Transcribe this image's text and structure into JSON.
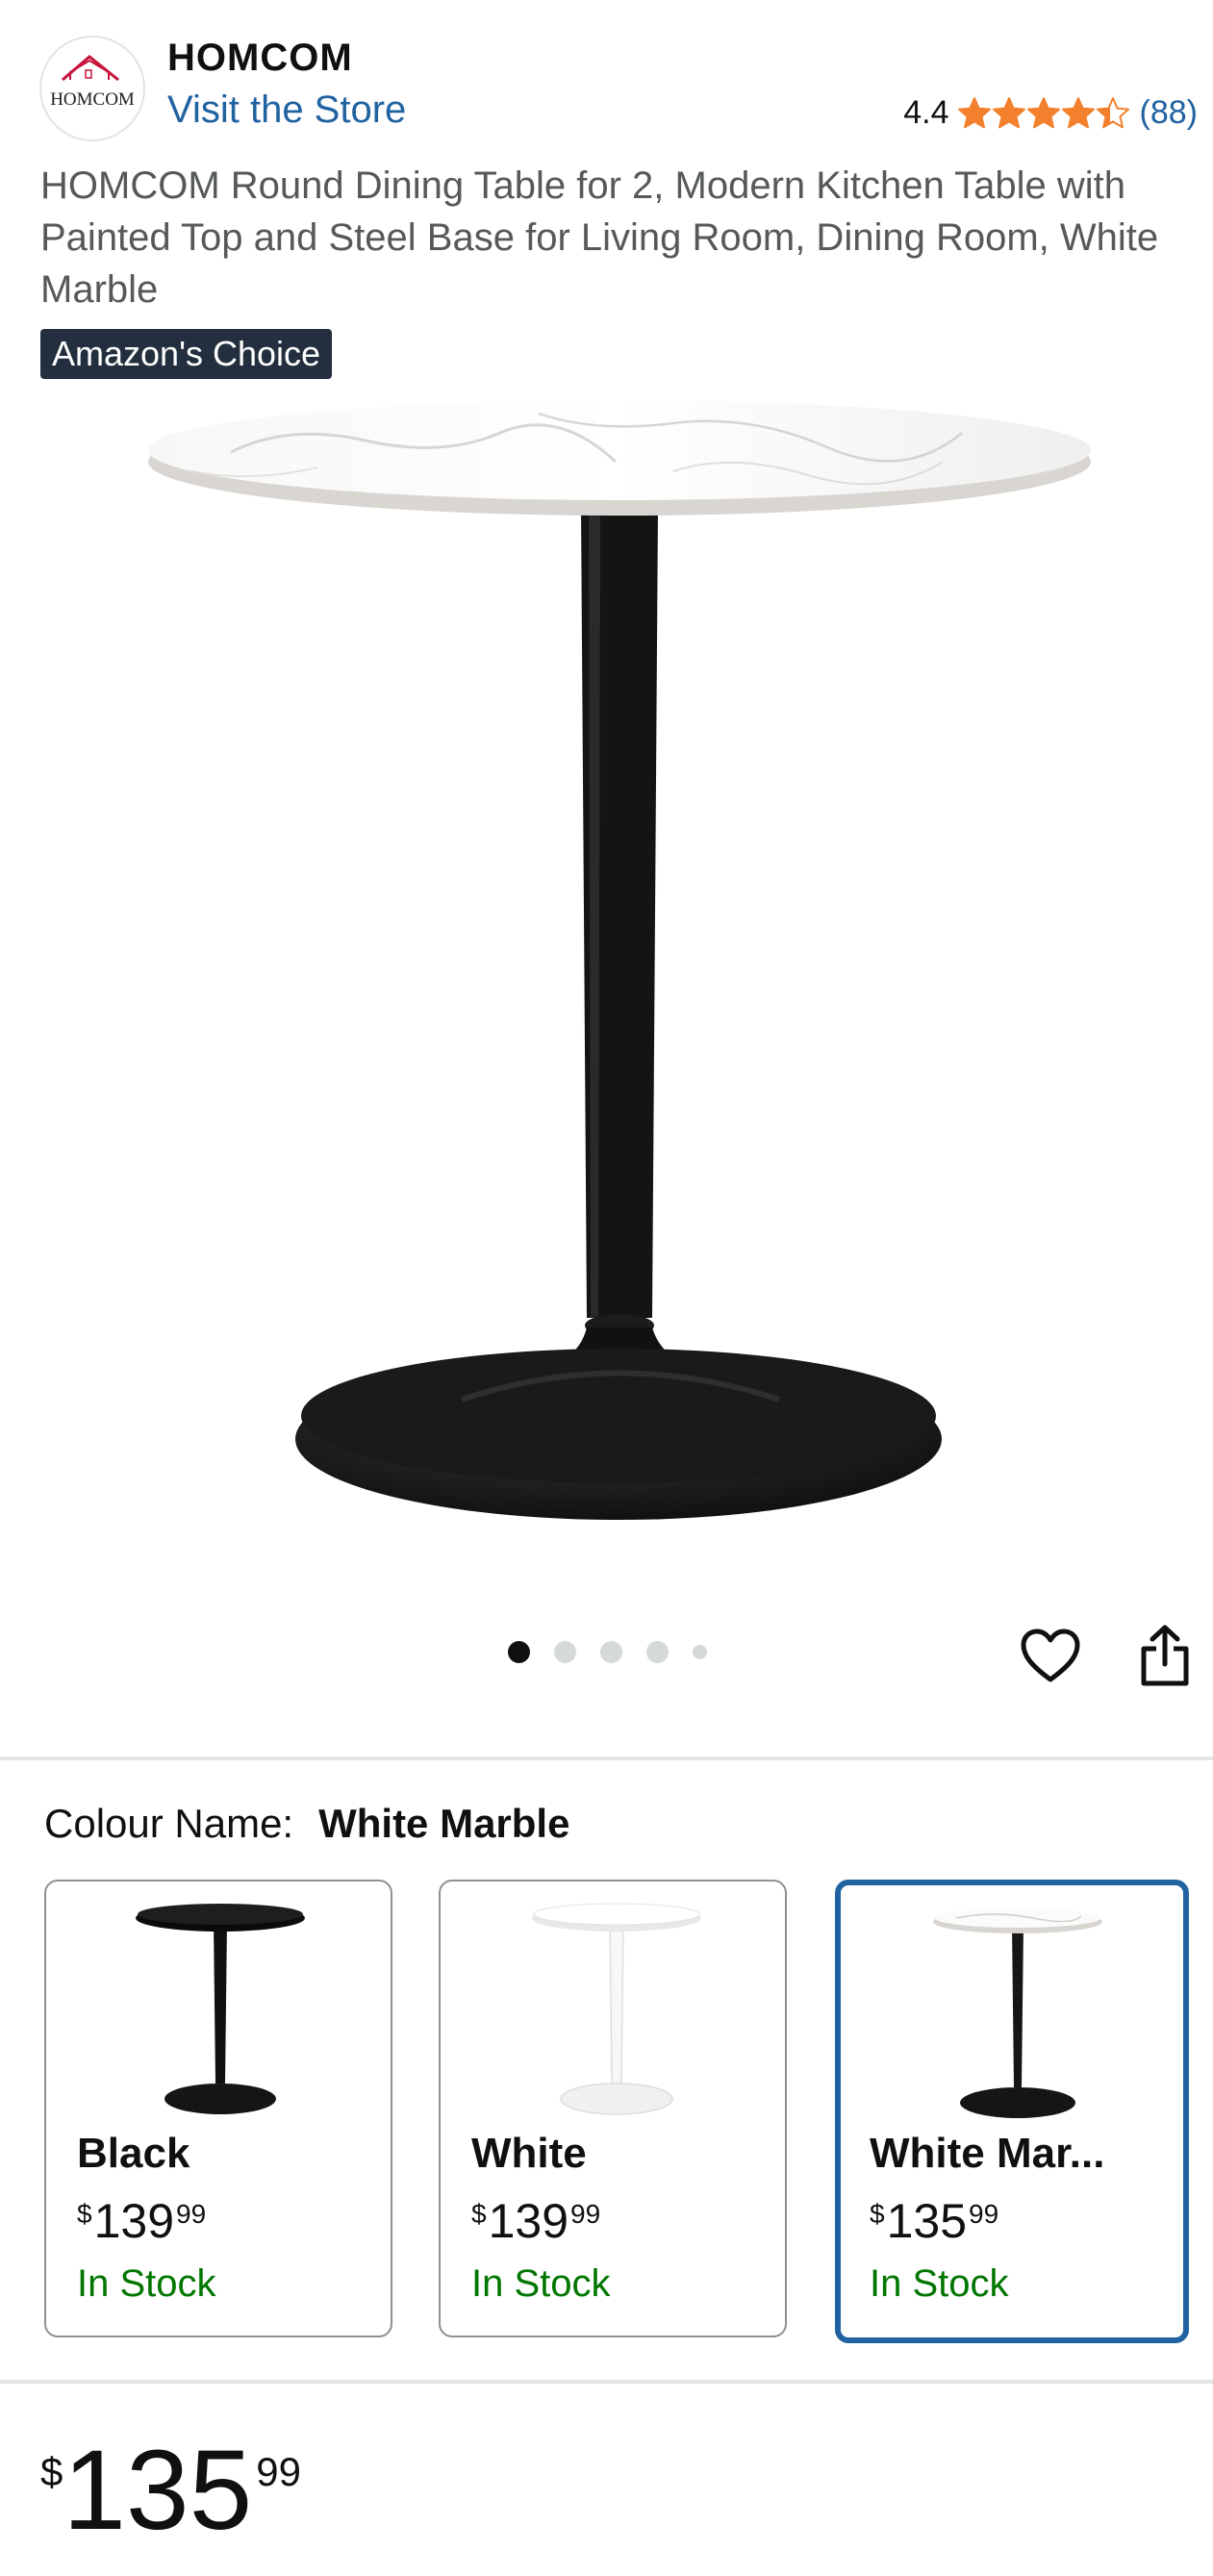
{
  "brand": {
    "logo_text": "HOMCOM",
    "name": "HOMCOM",
    "visit_store": "Visit the Store"
  },
  "rating": {
    "value": "4.4",
    "stars": 4.4,
    "count": "(88)",
    "star_color": "#f3802c"
  },
  "product": {
    "title": "HOMCOM Round Dining Table for 2, Modern Kitchen Table with Painted Top and Steel Base for Living Room, Dining Room, White Marble",
    "badge": "Amazon's Choice"
  },
  "gallery": {
    "image_count": 5,
    "active_index": 0
  },
  "actions": {
    "favorite_icon": "heart-icon",
    "share_icon": "share-icon"
  },
  "colour": {
    "label": "Colour Name:",
    "selected": "White Marble",
    "options": [
      {
        "name": "Black",
        "currency": "$",
        "whole": "139",
        "fraction": "99",
        "stock": "In Stock"
      },
      {
        "name": "White",
        "currency": "$",
        "whole": "139",
        "fraction": "99",
        "stock": "In Stock"
      },
      {
        "name": "White Mar...",
        "currency": "$",
        "whole": "135",
        "fraction": "99",
        "stock": "In Stock"
      }
    ]
  },
  "price": {
    "currency": "$",
    "whole": "135",
    "fraction": "99"
  },
  "colors": {
    "link": "#2162a1",
    "in_stock": "#007600",
    "selected_border": "#2162a1",
    "badge_bg": "#232f3e"
  }
}
